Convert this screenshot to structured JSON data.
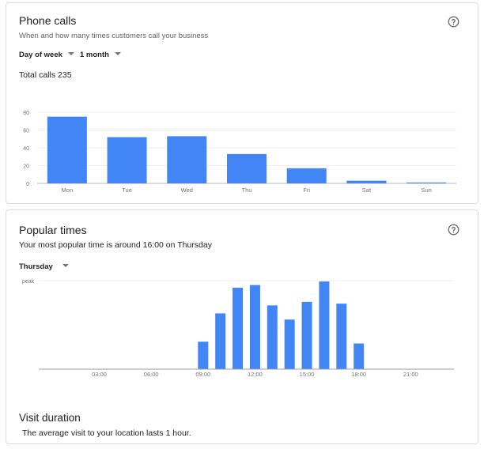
{
  "phone_calls": {
    "title": "Phone calls",
    "subtitle": "When and how many times customers call your business",
    "filter_day": "Day of week",
    "filter_range": "1 month",
    "total_label": "Total calls 235",
    "chart_data": {
      "type": "bar",
      "categories": [
        "Mon",
        "Tue",
        "Wed",
        "Thu",
        "Fri",
        "Sat",
        "Sun"
      ],
      "values": [
        75,
        52,
        53,
        33,
        17,
        3,
        1
      ],
      "yticks": [
        "80",
        "60",
        "40",
        "20",
        "0"
      ],
      "ylim": [
        0,
        80
      ],
      "grid": true,
      "color": "#4285f4"
    }
  },
  "popular_times": {
    "title": "Popular times",
    "subtitle": "Your most popular time is around 16:00 on Thursday",
    "filter_day": "Thursday",
    "peak_label": "peak",
    "chart_data": {
      "type": "bar",
      "x": [
        9,
        10,
        11,
        12,
        13,
        14,
        15,
        16,
        17,
        18
      ],
      "values": [
        31,
        63,
        92,
        95,
        72,
        56,
        76,
        99,
        74,
        29
      ],
      "xticks": [
        "03:00",
        "06:00",
        "09:00",
        "12:00",
        "15:00",
        "18:00",
        "21:00"
      ],
      "xtick_hours": [
        3,
        6,
        9,
        12,
        15,
        18,
        21
      ],
      "ylim": [
        0,
        100
      ],
      "color": "#4285f4"
    },
    "visit_duration_title": "Visit duration",
    "visit_duration_text": "The average visit to your location lasts 1 hour."
  },
  "icons": {
    "help": "help-circle-icon",
    "dropdown": "caret-down-icon"
  }
}
